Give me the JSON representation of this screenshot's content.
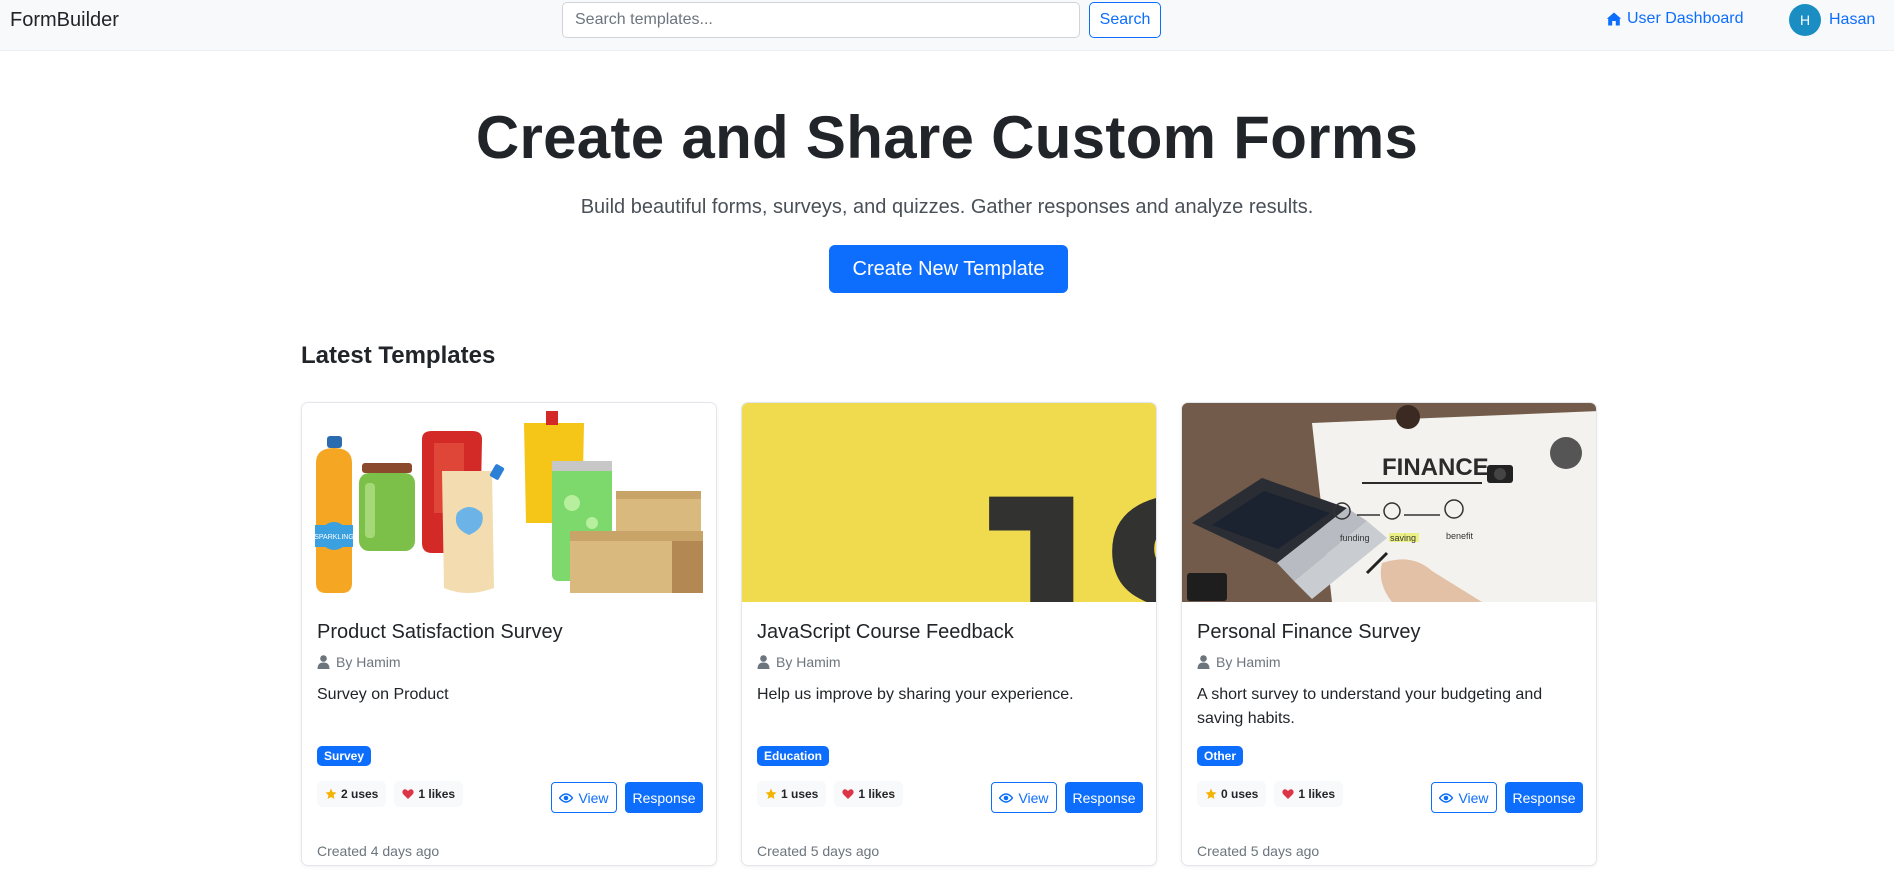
{
  "nav": {
    "brand": "FormBuilder",
    "search_placeholder": "Search templates...",
    "search_button": "Search",
    "dashboard_link": "User Dashboard",
    "user_initial": "H",
    "user_name": "Hasan"
  },
  "hero": {
    "title": "Create and Share Custom Forms",
    "subtitle": "Build beautiful forms, surveys, and quizzes. Gather responses and analyze results.",
    "create_button": "Create New Template"
  },
  "section_title": "Latest Templates",
  "cards": [
    {
      "title": "Product Satisfaction Survey",
      "author": "By Hamim",
      "description": "Survey on Product",
      "tag": "Survey",
      "uses": "2 uses",
      "likes": "1 likes",
      "view_label": "View",
      "response_label": "Response",
      "created": "Created 4 days ago",
      "image_text": "SPARKLING"
    },
    {
      "title": "JavaScript Course Feedback",
      "author": "By Hamim",
      "description": "Help us improve by sharing your experience.",
      "tag": "Education",
      "uses": "1 uses",
      "likes": "1 likes",
      "view_label": "View",
      "response_label": "Response",
      "created": "Created 5 days ago",
      "image_text": "JS"
    },
    {
      "title": "Personal Finance Survey",
      "author": "By Hamim",
      "description": "A short survey to understand your budgeting and saving habits.",
      "tag": "Other",
      "uses": "0 uses",
      "likes": "1 likes",
      "view_label": "View",
      "response_label": "Response",
      "created": "Created 5 days ago",
      "image_text": "FINANCE",
      "image_words": [
        "funding",
        "saving",
        "benefit"
      ]
    }
  ],
  "colors": {
    "primary": "#0d6efd",
    "navbar_bg": "#f8f9fa",
    "avatar": "#1a8ec2",
    "js_yellow": "#f0db4f",
    "star": "#f5b301",
    "heart": "#dc3545"
  },
  "icons": [
    "home-icon",
    "user-icon",
    "star-icon",
    "heart-icon",
    "eye-icon"
  ]
}
